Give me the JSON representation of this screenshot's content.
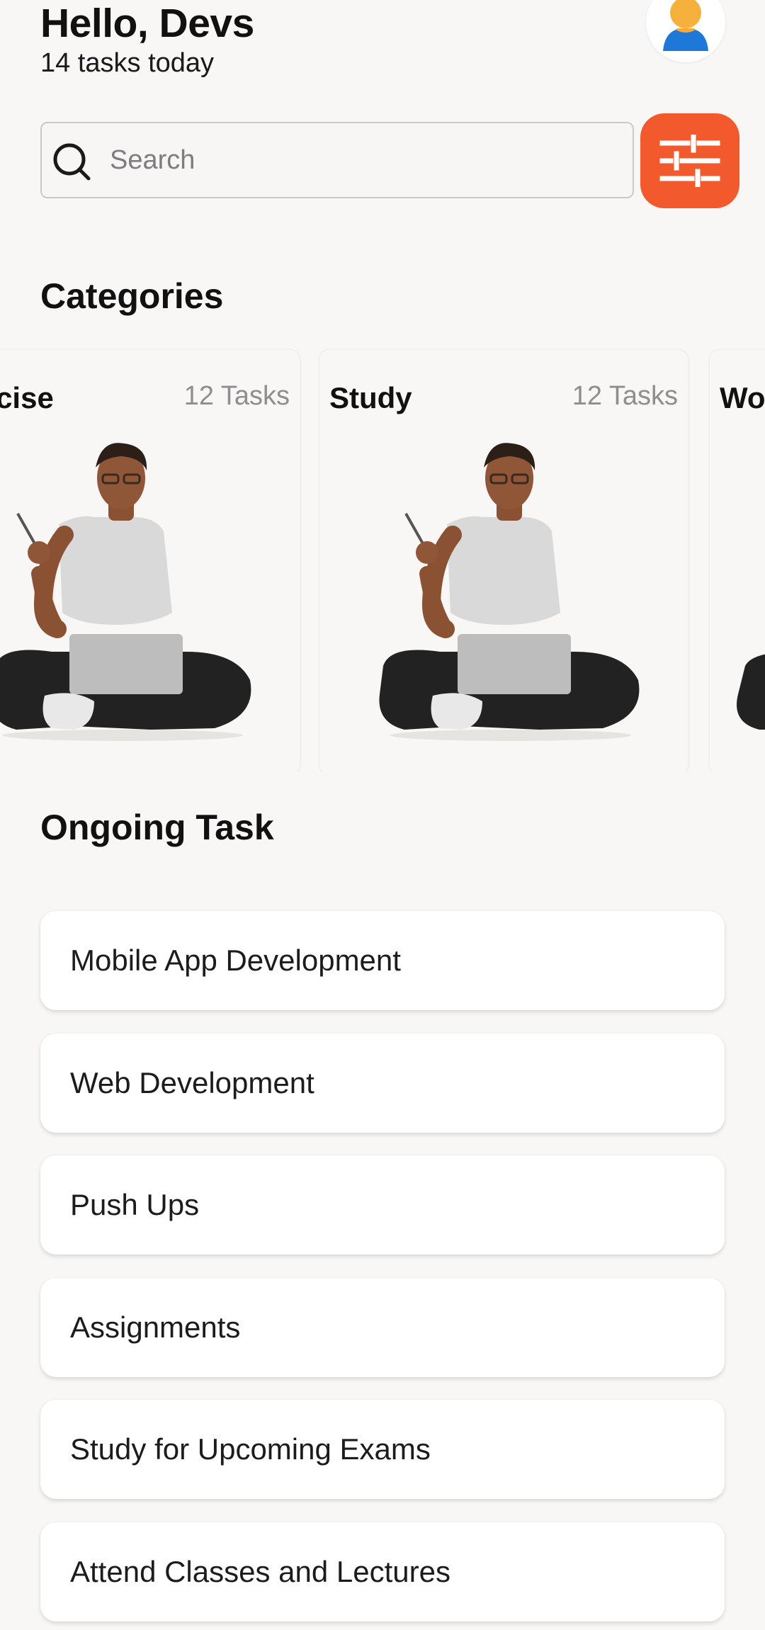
{
  "header": {
    "greeting": "Hello, Devs",
    "subtitle": "14 tasks today",
    "avatar_icon": "person-avatar-icon"
  },
  "search": {
    "placeholder": "Search",
    "value": "",
    "icon": "search-icon"
  },
  "filter": {
    "icon": "sliders-icon",
    "color": "#f25a2d"
  },
  "categories": {
    "title": "Categories",
    "items": [
      {
        "name": "Exercise",
        "count": "12 Tasks"
      },
      {
        "name": "Study",
        "count": "12 Tasks"
      },
      {
        "name": "Work",
        "count": ""
      }
    ]
  },
  "ongoing": {
    "title": "Ongoing Task",
    "tasks": [
      {
        "label": "Mobile App Development"
      },
      {
        "label": "Web Development"
      },
      {
        "label": "Push Ups"
      },
      {
        "label": "Assignments"
      },
      {
        "label": "Study for Upcoming Exams"
      },
      {
        "label": "Attend Classes and Lectures"
      }
    ]
  },
  "colors": {
    "accent": "#f25a2d",
    "background": "#f8f7f5",
    "card": "#ffffff"
  }
}
